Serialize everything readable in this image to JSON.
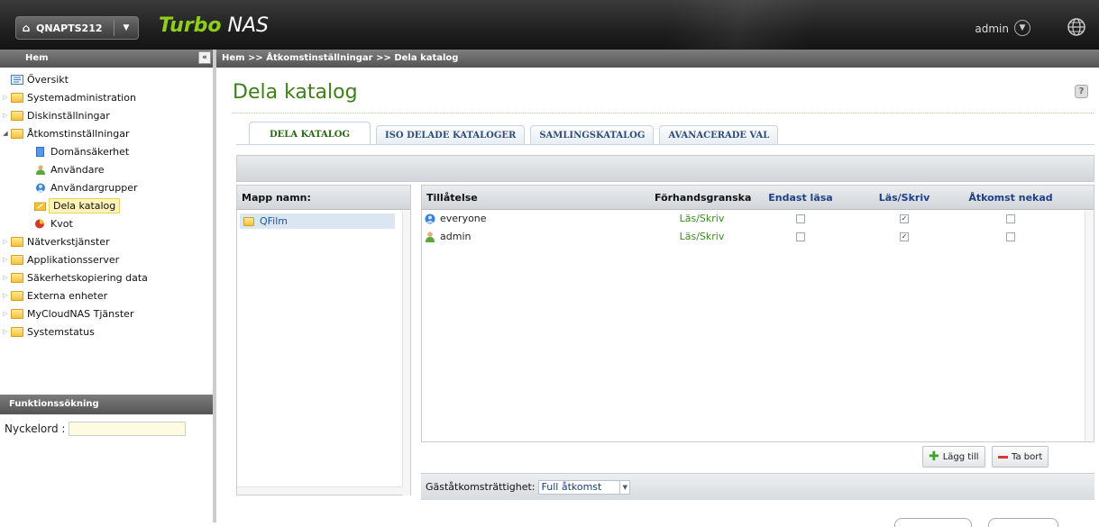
{
  "topbar": {
    "device_name": "QNAPTS212",
    "brand_turbo": "Turbo",
    "brand_nas": " NAS",
    "user": "admin"
  },
  "sidebar": {
    "header": "Hem",
    "collapse_label": "«",
    "items": [
      {
        "label": "Översikt"
      },
      {
        "label": "Systemadministration"
      },
      {
        "label": "Diskinställningar"
      },
      {
        "label": "Åtkomstinställningar"
      },
      {
        "label": "Domänsäkerhet"
      },
      {
        "label": "Användare"
      },
      {
        "label": "Användargrupper"
      },
      {
        "label": "Dela katalog"
      },
      {
        "label": "Kvot"
      },
      {
        "label": "Nätverkstjänster"
      },
      {
        "label": "Applikationsserver"
      },
      {
        "label": "Säkerhetskopiering data"
      },
      {
        "label": "Externa enheter"
      },
      {
        "label": "MyCloudNAS Tjänster"
      },
      {
        "label": "Systemstatus"
      }
    ],
    "search_header": "Funktionssökning",
    "keyword_label": "Nyckelord :"
  },
  "main": {
    "breadcrumb": "Hem >> Åtkomstinställningar >> Dela katalog",
    "title": "Dela katalog",
    "help_label": "?",
    "tabs": [
      {
        "label": "DELA KATALOG"
      },
      {
        "label": "ISO DELADE KATALOGER"
      },
      {
        "label": "SAMLINGSKATALOG"
      },
      {
        "label": "AVANACERADE VAL"
      }
    ],
    "folder_header": "Mapp namn:",
    "folders": [
      {
        "name": "QFilm"
      }
    ],
    "perm_headers": {
      "permission": "Tillåtelse",
      "preview": "Förhandsgranska",
      "read_only": "Endast läsa",
      "read_write": "Läs/Skriv",
      "deny": "Åtkomst nekad"
    },
    "perm_rows": [
      {
        "name": "everyone",
        "preview": "Läs/Skriv",
        "read_only": "",
        "read_write": "✓",
        "deny": ""
      },
      {
        "name": "admin",
        "preview": "Läs/Skriv",
        "read_only": "",
        "read_write": "✓",
        "deny": ""
      }
    ],
    "add_button": "Lägg till",
    "remove_button": "Ta bort",
    "guest_label": "Gäståtkomsträttighet:",
    "guest_value": "Full åtkomst"
  },
  "colors": {
    "title_green": "#3f7f1b",
    "brand_green": "#8fcf1c",
    "header_blue": "#1f3f86"
  }
}
